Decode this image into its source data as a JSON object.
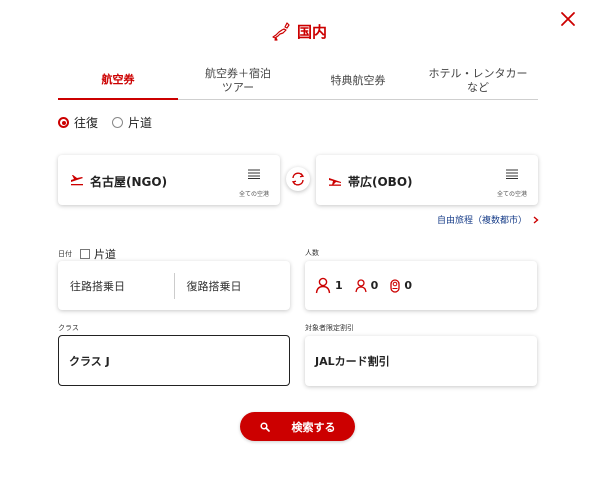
{
  "header": {
    "title": "国内",
    "map_icon": "japan-map-icon",
    "close_icon": "close-icon",
    "accent": "#cc0000"
  },
  "tabs": [
    {
      "label": "航空券",
      "active": true
    },
    {
      "label": "航空券＋宿泊\nツアー",
      "active": false
    },
    {
      "label": "特典航空券",
      "active": false
    },
    {
      "label": "ホテル・レンタカー\nなど",
      "active": false
    }
  ],
  "trip_type": {
    "options": [
      {
        "label": "往復",
        "selected": true
      },
      {
        "label": "片道",
        "selected": false
      }
    ]
  },
  "departure": {
    "name": "名古屋(NGO)",
    "list_label": "全ての空港"
  },
  "arrival": {
    "name": "帯広(OBO)",
    "list_label": "全ての空港"
  },
  "free_itinerary_link": "自由旅程（複数都市）",
  "dates": {
    "label": "日付",
    "oneway_checkbox": "片道",
    "outbound_placeholder": "往路搭乗日",
    "return_placeholder": "復路搭乗日"
  },
  "passengers": {
    "label": "人数",
    "adult": "1",
    "child": "0",
    "infant": "0"
  },
  "cabin_class": {
    "label": "クラス",
    "value": "クラス J"
  },
  "discount": {
    "label": "対象者限定割引",
    "value": "JALカード割引"
  },
  "search_button": {
    "label": "検索する"
  }
}
